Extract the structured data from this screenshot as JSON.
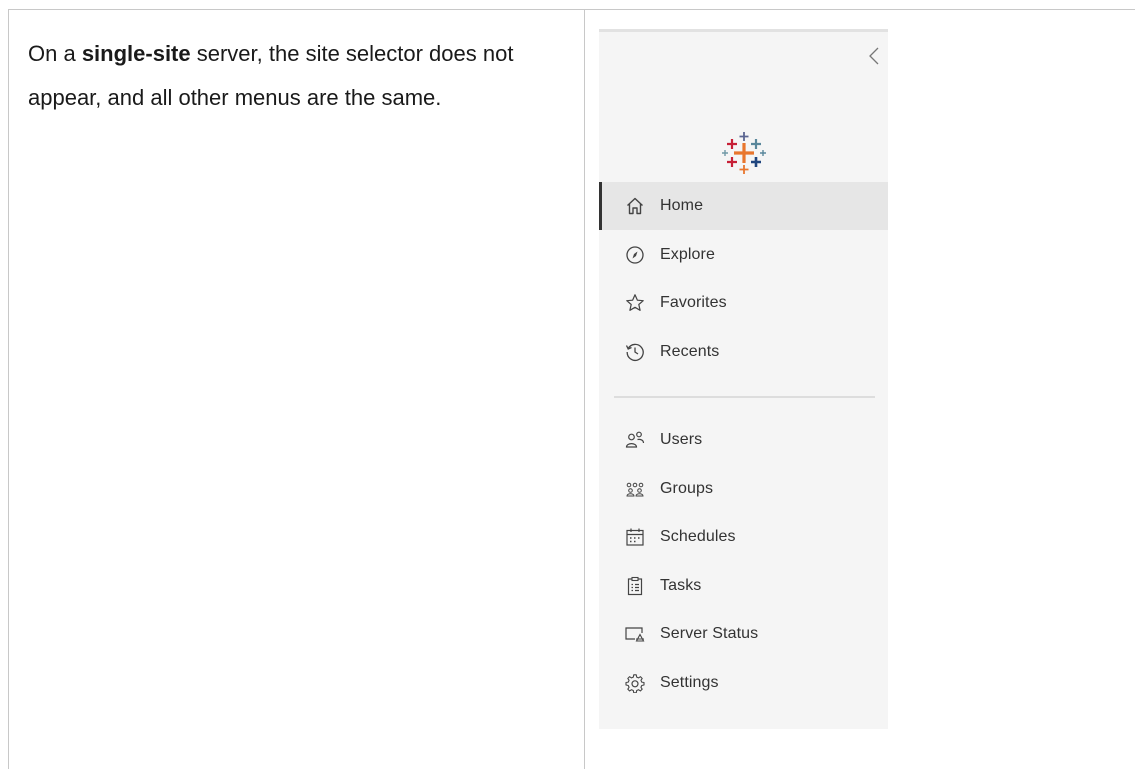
{
  "description": {
    "prefix": "On a ",
    "emphasis": "single-site",
    "suffix": " server, the site selector does not appear, and all other menus are the same."
  },
  "nav": {
    "collapse_icon": "chevron-left-icon",
    "logo_icon": "tableau-logo",
    "primary": [
      {
        "label": "Home",
        "icon": "home-icon",
        "active": true
      },
      {
        "label": "Explore",
        "icon": "compass-icon"
      },
      {
        "label": "Favorites",
        "icon": "star-icon"
      },
      {
        "label": "Recents",
        "icon": "history-icon"
      }
    ],
    "admin": [
      {
        "label": "Users",
        "icon": "users-icon"
      },
      {
        "label": "Groups",
        "icon": "groups-icon"
      },
      {
        "label": "Schedules",
        "icon": "calendar-icon"
      },
      {
        "label": "Tasks",
        "icon": "clipboard-icon"
      },
      {
        "label": "Server Status",
        "icon": "server-status-icon"
      },
      {
        "label": "Settings",
        "icon": "gear-icon"
      }
    ]
  },
  "colors": {
    "panel_bg": "#f5f5f5",
    "active_bg": "#e6e6e6",
    "text": "#333333",
    "logo_orange": "#e8762d",
    "logo_blue": "#5b6591",
    "logo_red": "#c72037",
    "logo_teal": "#59879b",
    "logo_navy": "#1f457e"
  }
}
